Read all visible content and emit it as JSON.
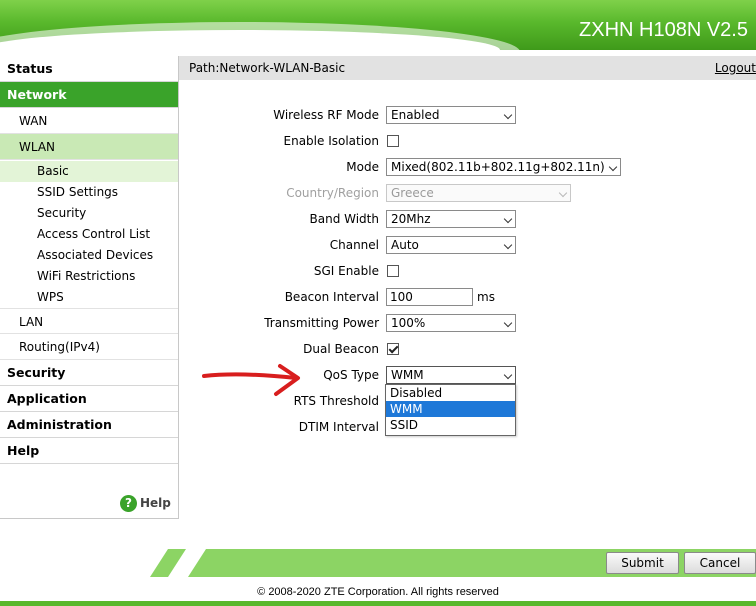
{
  "header": {
    "brand": "ZXHN H108N V2.5"
  },
  "sidebar": {
    "status": "Status",
    "network": "Network",
    "wan": "WAN",
    "wlan": "WLAN",
    "wlan_items": [
      "Basic",
      "SSID Settings",
      "Security",
      "Access Control List",
      "Associated Devices",
      "WiFi Restrictions",
      "WPS"
    ],
    "lan": "LAN",
    "routing": "Routing(IPv4)",
    "security": "Security",
    "application": "Application",
    "administration": "Administration",
    "help_section": "Help",
    "help_link": "Help",
    "help_icon": "?"
  },
  "pathbar": {
    "path": "Path:Network-WLAN-Basic",
    "logout": "Logout"
  },
  "form": {
    "rf_mode": {
      "label": "Wireless RF Mode",
      "value": "Enabled"
    },
    "isolation": {
      "label": "Enable Isolation",
      "checked": false
    },
    "mode": {
      "label": "Mode",
      "value": "Mixed(802.11b+802.11g+802.11n)"
    },
    "country": {
      "label": "Country/Region",
      "value": "Greece"
    },
    "bandwidth": {
      "label": "Band Width",
      "value": "20Mhz"
    },
    "channel": {
      "label": "Channel",
      "value": "Auto"
    },
    "sgi": {
      "label": "SGI Enable",
      "checked": false
    },
    "beacon": {
      "label": "Beacon Interval",
      "value": "100",
      "unit": "ms"
    },
    "tx_power": {
      "label": "Transmitting Power",
      "value": "100%"
    },
    "dual_beacon": {
      "label": "Dual Beacon",
      "checked": true
    },
    "qos": {
      "label": "QoS Type",
      "value": "WMM",
      "options": [
        "Disabled",
        "WMM",
        "SSID"
      ]
    },
    "rts": {
      "label": "RTS Threshold"
    },
    "dtim": {
      "label": "DTIM Interval"
    }
  },
  "buttons": {
    "submit": "Submit",
    "cancel": "Cancel"
  },
  "footer": {
    "copyright": "© 2008-2020 ZTE Corporation. All rights reserved"
  },
  "colors": {
    "brand_green": "#3aa32a",
    "header_green": "#59b82c",
    "annotation_red": "#d81e1e",
    "selection_blue": "#1e78d8"
  }
}
